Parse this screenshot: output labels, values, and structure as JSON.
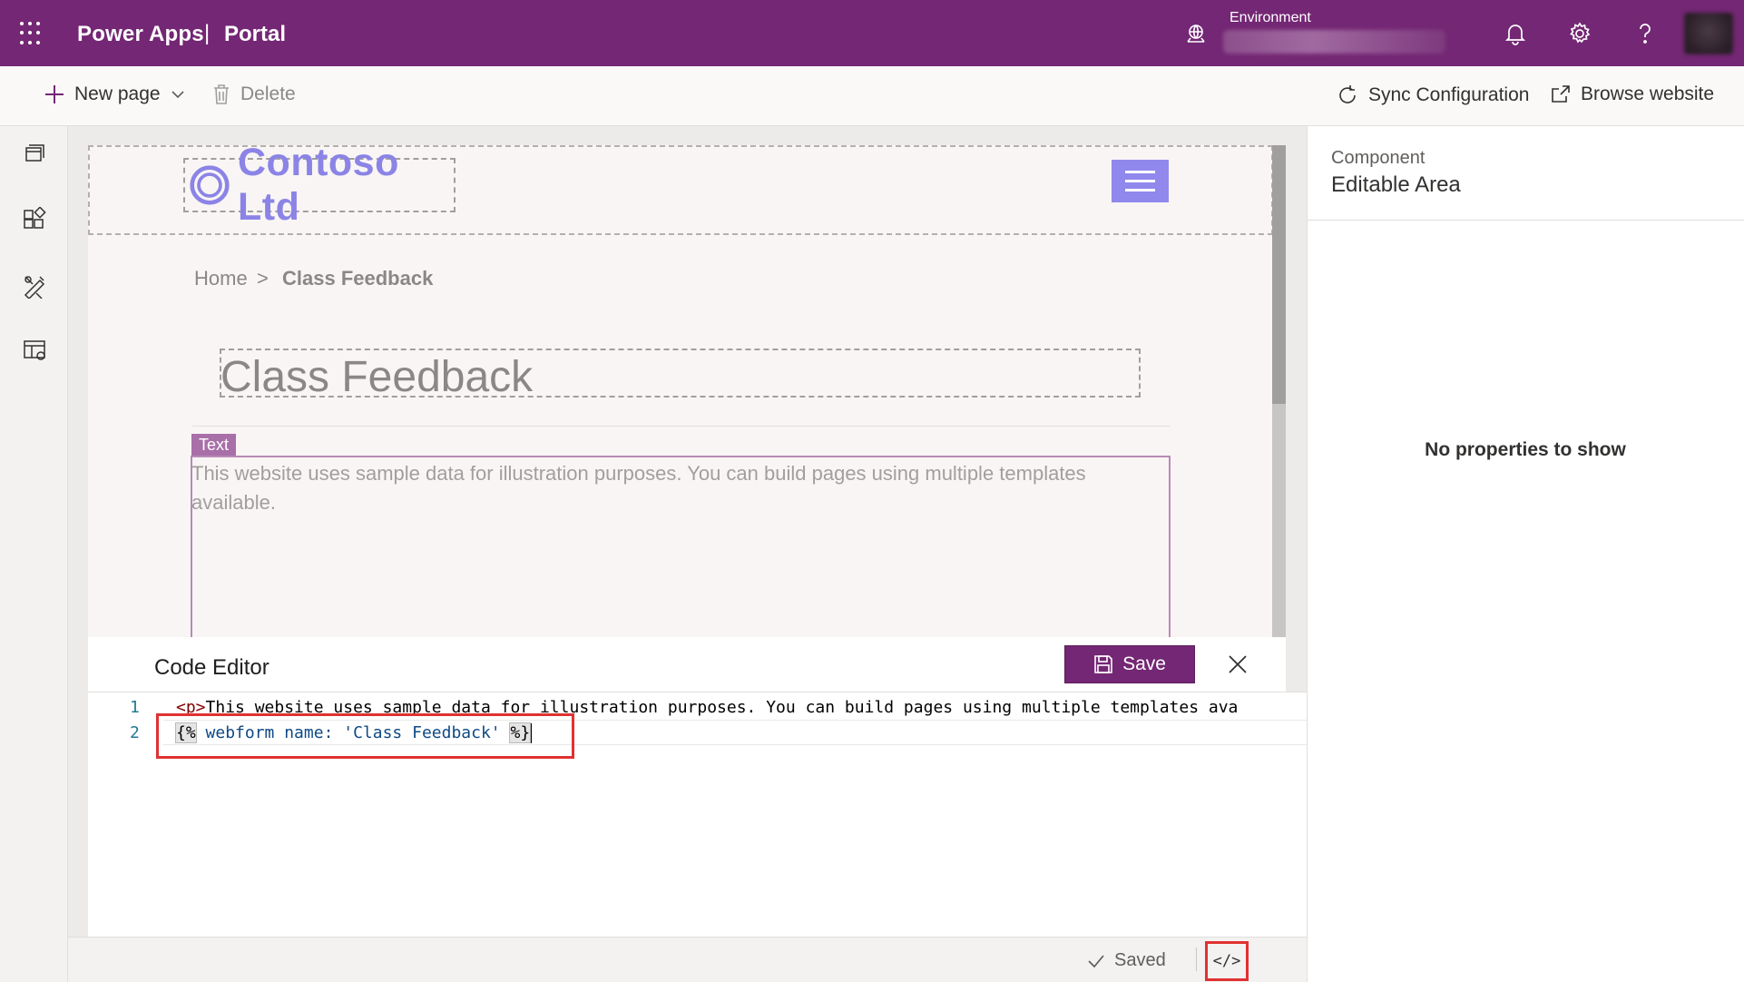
{
  "header": {
    "app_name": "Power Apps",
    "separator": "|",
    "area": "Portal",
    "environment_label": "Environment",
    "environment_value": ""
  },
  "commands": {
    "new_page": "New page",
    "delete": "Delete",
    "sync": "Sync Configuration",
    "browse": "Browse website"
  },
  "site": {
    "logo_text": "Contoso Ltd",
    "breadcrumb_home": "Home",
    "breadcrumb_sep": ">",
    "breadcrumb_current": "Class Feedback",
    "page_title": "Class Feedback",
    "text_tag": "Text",
    "text_content": "This website uses sample data for illustration purposes. You can build pages using multiple templates available."
  },
  "code_editor": {
    "title": "Code Editor",
    "save_label": "Save",
    "lines": [
      {
        "num": "1",
        "tag_open": "<p>",
        "text": "This website uses sample data for illustration purposes. You can build pages using multiple templates ava"
      },
      {
        "num": "2",
        "open": "{%",
        "liquid": " webform name: ",
        "string": "'Class Feedback'",
        "close": "%}"
      }
    ]
  },
  "status": {
    "saved": "Saved",
    "code_toggle": "</>"
  },
  "properties": {
    "label": "Component",
    "title": "Editable Area",
    "empty": "No properties to show"
  },
  "colors": {
    "brand": "#742774",
    "logo": "#8b84e6",
    "highlight": "#e03131"
  }
}
